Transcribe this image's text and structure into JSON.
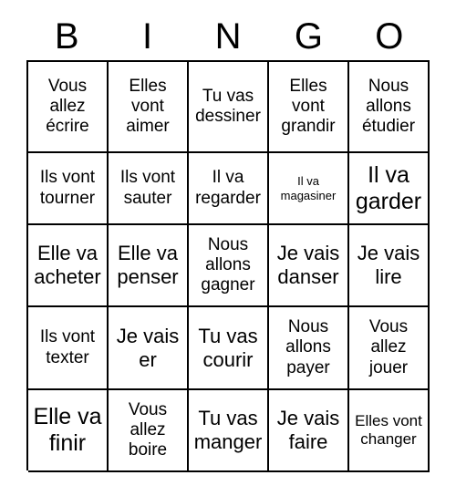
{
  "header": {
    "letters": [
      "B",
      "I",
      "N",
      "G",
      "O"
    ]
  },
  "grid": {
    "columns": 5,
    "rows": 5,
    "border_color": "#000000",
    "background_color": "#ffffff",
    "text_color": "#000000",
    "cells": [
      {
        "text": "Vous allez écrire",
        "size": "md"
      },
      {
        "text": "Elles vont aimer",
        "size": "md"
      },
      {
        "text": "Tu vas dessiner",
        "size": "md"
      },
      {
        "text": "Elles vont grandir",
        "size": "md"
      },
      {
        "text": "Nous allons étudier",
        "size": "md"
      },
      {
        "text": "Ils vont tourner",
        "size": "md"
      },
      {
        "text": "Ils vont sauter",
        "size": "md"
      },
      {
        "text": "Il va regarder",
        "size": "md"
      },
      {
        "text": "Il va magasiner",
        "size": "xs"
      },
      {
        "text": "Il va garder",
        "size": "xl"
      },
      {
        "text": "Elle va acheter",
        "size": "lg"
      },
      {
        "text": "Elle va penser",
        "size": "lg"
      },
      {
        "text": "Nous allons gagner",
        "size": "md"
      },
      {
        "text": "Je vais danser",
        "size": "lg"
      },
      {
        "text": "Je vais lire",
        "size": "lg"
      },
      {
        "text": "Ils vont texter",
        "size": "md"
      },
      {
        "text": "Je vais er",
        "size": "lg"
      },
      {
        "text": "Tu vas courir",
        "size": "lg"
      },
      {
        "text": "Nous allons payer",
        "size": "md"
      },
      {
        "text": "Vous allez jouer",
        "size": "md"
      },
      {
        "text": "Elle va finir",
        "size": "xl"
      },
      {
        "text": "Vous allez boire",
        "size": "md"
      },
      {
        "text": "Tu vas manger",
        "size": "lg"
      },
      {
        "text": "Je vais faire",
        "size": "lg"
      },
      {
        "text": "Elles vont changer",
        "size": "sm"
      }
    ]
  }
}
